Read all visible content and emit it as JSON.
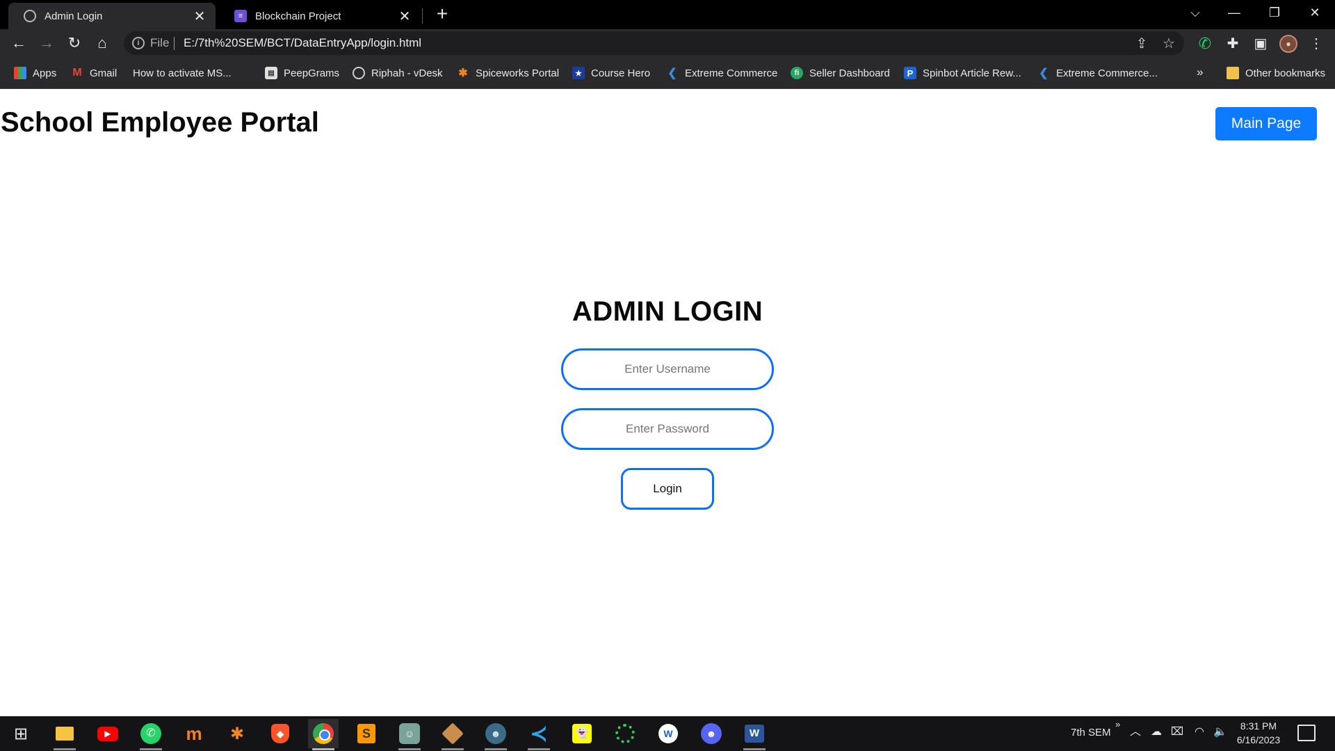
{
  "browser": {
    "tabs": [
      {
        "title": "Admin Login",
        "icon": "globe-icon",
        "active": true
      },
      {
        "title": "Blockchain Project",
        "icon": "document-icon",
        "active": false
      }
    ],
    "address": {
      "scheme": "File",
      "url": "E:/7th%20SEM/BCT/DataEntryApp/login.html"
    },
    "bookmarks": [
      {
        "label": "Apps",
        "icon": "apps-grid-icon"
      },
      {
        "label": "Gmail",
        "icon": "gmail-icon"
      },
      {
        "label": "How to activate MS...",
        "icon": "page-icon"
      },
      {
        "label": "PeepGrams",
        "icon": "peepgrams-icon"
      },
      {
        "label": "Riphah - vDesk",
        "icon": "globe-icon"
      },
      {
        "label": "Spiceworks Portal",
        "icon": "spiceworks-icon"
      },
      {
        "label": "Course Hero",
        "icon": "course-hero-icon"
      },
      {
        "label": "Extreme Commerce",
        "icon": "extreme-commerce-icon"
      },
      {
        "label": "Seller Dashboard",
        "icon": "seller-dashboard-icon"
      },
      {
        "label": "Spinbot Article Rew...",
        "icon": "spinbot-icon"
      },
      {
        "label": "Extreme Commerce...",
        "icon": "extreme-commerce-icon"
      }
    ],
    "bookmarks_more": "»",
    "other_bookmarks": "Other bookmarks"
  },
  "page": {
    "portal_title": "School Employee Portal",
    "main_page_button": "Main Page",
    "login_heading": "ADMIN LOGIN",
    "username_placeholder": "Enter Username",
    "password_placeholder": "Enter Password",
    "login_button": "Login"
  },
  "taskbar": {
    "tray_label": "7th SEM",
    "time": "8:31 PM",
    "date": "6/16/2023"
  },
  "colors": {
    "accent_blue": "#0d6efd",
    "main_page_button_bg": "#0d7bff",
    "browser_dark": "#2a2a2c"
  }
}
